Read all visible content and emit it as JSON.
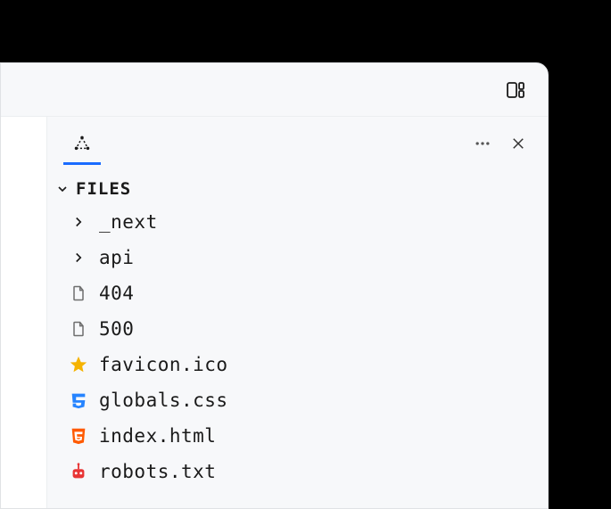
{
  "section": {
    "title": "FILES",
    "expanded": true
  },
  "header": {
    "layout_icon": "layout-columns-icon",
    "tab_icon": "triangle-dots-icon",
    "more_icon": "more-horizontal-icon",
    "close_icon": "close-icon"
  },
  "tree": [
    {
      "kind": "folder",
      "name": "_next",
      "icon": "chevron-right-icon"
    },
    {
      "kind": "folder",
      "name": "api",
      "icon": "chevron-right-icon"
    },
    {
      "kind": "file",
      "name": "404",
      "icon": "file-icon",
      "color": "#6e6e6e"
    },
    {
      "kind": "file",
      "name": "500",
      "icon": "file-icon",
      "color": "#6e6e6e"
    },
    {
      "kind": "file",
      "name": "favicon.ico",
      "icon": "star-icon",
      "color": "#f5b300"
    },
    {
      "kind": "file",
      "name": "globals.css",
      "icon": "css-icon",
      "color": "#2684ff"
    },
    {
      "kind": "file",
      "name": "index.html",
      "icon": "html-icon",
      "color": "#ff5a00"
    },
    {
      "kind": "file",
      "name": "robots.txt",
      "icon": "robot-icon",
      "color": "#e83535"
    }
  ]
}
